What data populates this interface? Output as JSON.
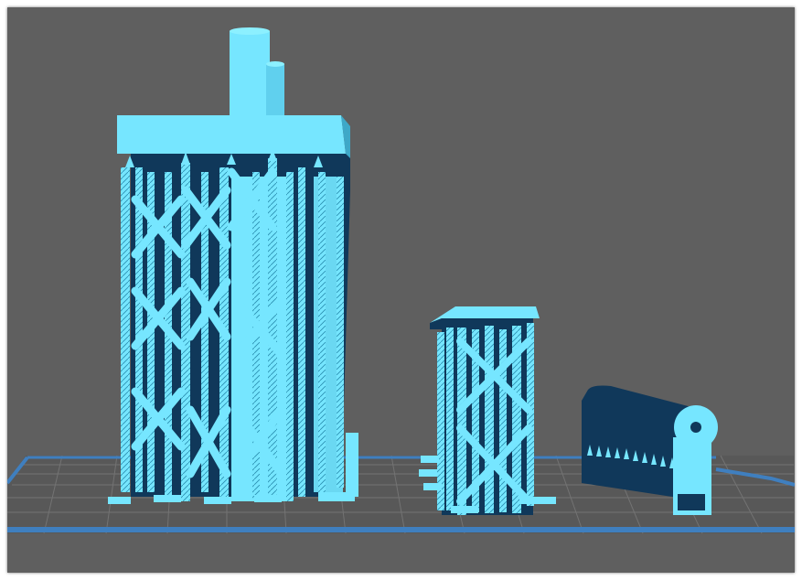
{
  "viewport": {
    "background": "#5f5f5f",
    "build_plate_color": "#3f7fbf",
    "grid_color": "#6a6a6a",
    "model_color": "#76e6ff",
    "model_shadow_color": "#10385a"
  },
  "scene": {
    "models": [
      {
        "name": "tall-part",
        "supported": true
      },
      {
        "name": "small-part",
        "supported": true
      },
      {
        "name": "lying-cylinder-part",
        "supported": true
      }
    ]
  }
}
